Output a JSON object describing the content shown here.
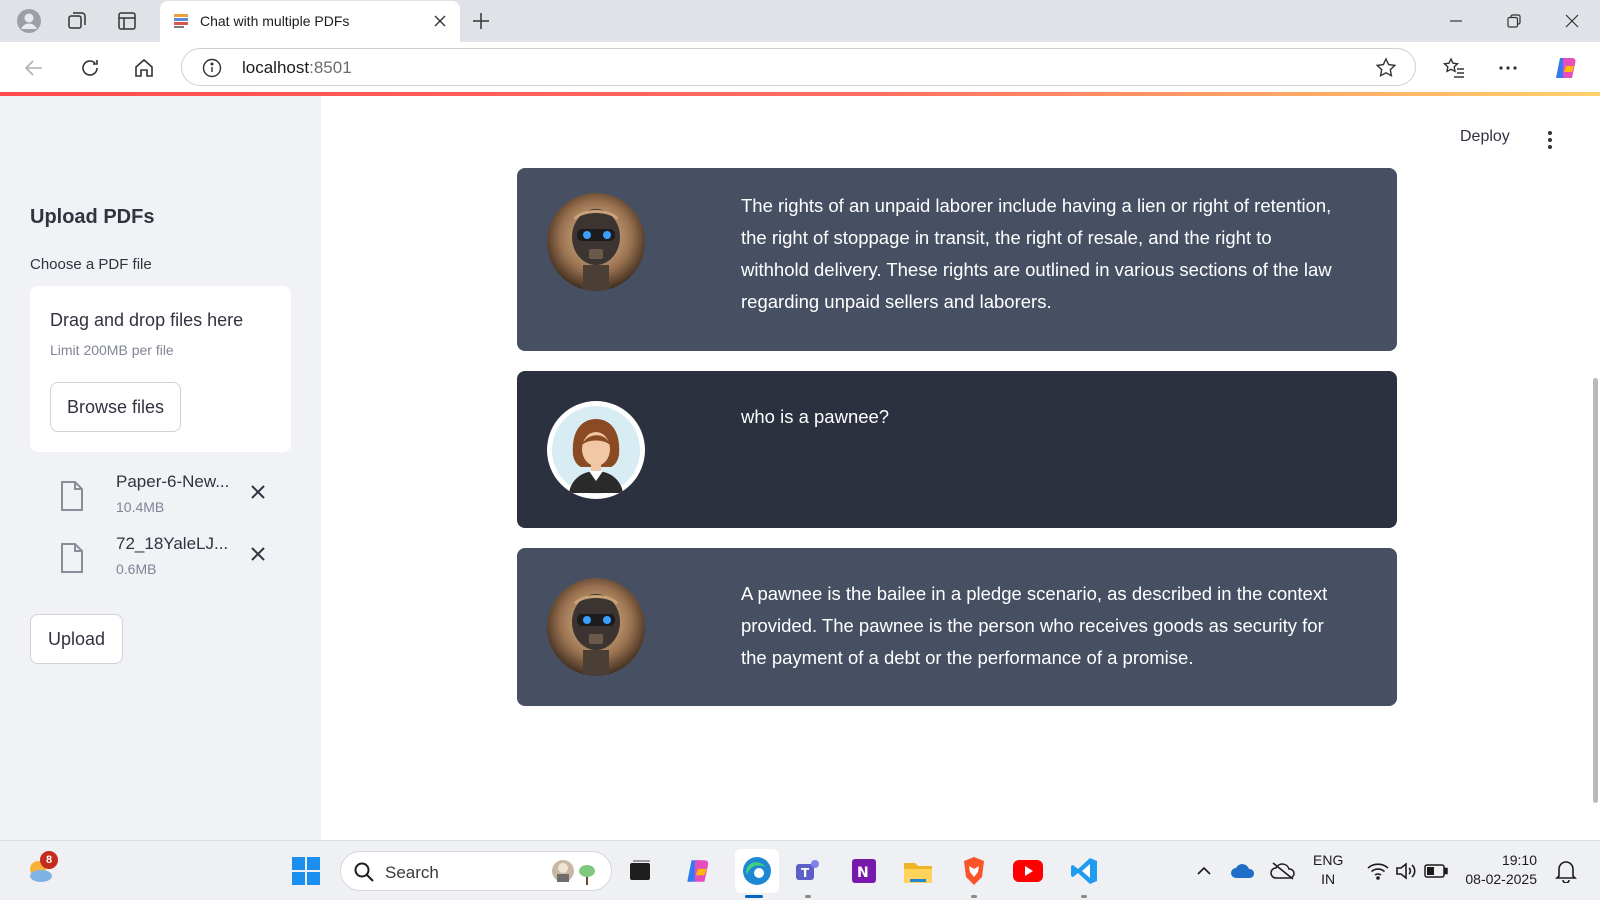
{
  "browser": {
    "tab_title": "Chat with multiple PDFs",
    "url_host": "localhost",
    "url_port": ":8501"
  },
  "sidebar": {
    "title": "Upload PDFs",
    "file_label": "Choose a PDF file",
    "dropzone_title": "Drag and drop files here",
    "dropzone_limit": "Limit 200MB per file",
    "browse_label": "Browse files",
    "files": [
      {
        "name": "Paper-6-New...",
        "size": "10.4MB"
      },
      {
        "name": "72_18YaleLJ...",
        "size": "0.6MB"
      }
    ],
    "upload_label": "Upload"
  },
  "header": {
    "deploy_label": "Deploy"
  },
  "chat": {
    "messages": [
      {
        "role": "bot",
        "text": "The rights of an unpaid laborer include having a lien or right of retention, the right of stoppage in transit, the right of resale, and the right to withhold delivery. These rights are outlined in various sections of the law regarding unpaid sellers and laborers."
      },
      {
        "role": "user",
        "text": "who is a pawnee?"
      },
      {
        "role": "bot",
        "text": "A pawnee is the bailee in a pledge scenario, as described in the context provided. The pawnee is the person who receives goods as security for the payment of a debt or the performance of a promise."
      }
    ]
  },
  "taskbar": {
    "weather_badge": "8",
    "search_placeholder": "Search",
    "lang_line1": "ENG",
    "lang_line2": "IN",
    "time": "19:10",
    "date": "08-02-2025"
  },
  "colors": {
    "bot_bg": "#475063",
    "user_bg": "#2b313e",
    "sidebar_bg": "#f0f2f6",
    "accent_red": "#ff4b4b"
  },
  "icons": [
    "profile-icon",
    "collections-icon",
    "tab-actions-icon",
    "pdf-favicon",
    "close-icon",
    "plus-icon",
    "minimize-icon",
    "restore-icon",
    "back-icon",
    "refresh-icon",
    "home-icon",
    "info-icon",
    "star-icon",
    "favorites-icon",
    "more-icon",
    "copilot-icon",
    "file-icon",
    "robot-avatar",
    "woman-avatar",
    "weather-icon",
    "windows-icon",
    "search-icon",
    "edge-icon",
    "teams-icon",
    "onenote-icon",
    "folder-icon",
    "brave-icon",
    "youtube-icon",
    "vscode-icon",
    "wifi-icon",
    "volume-icon",
    "battery-icon",
    "notification-icon"
  ]
}
